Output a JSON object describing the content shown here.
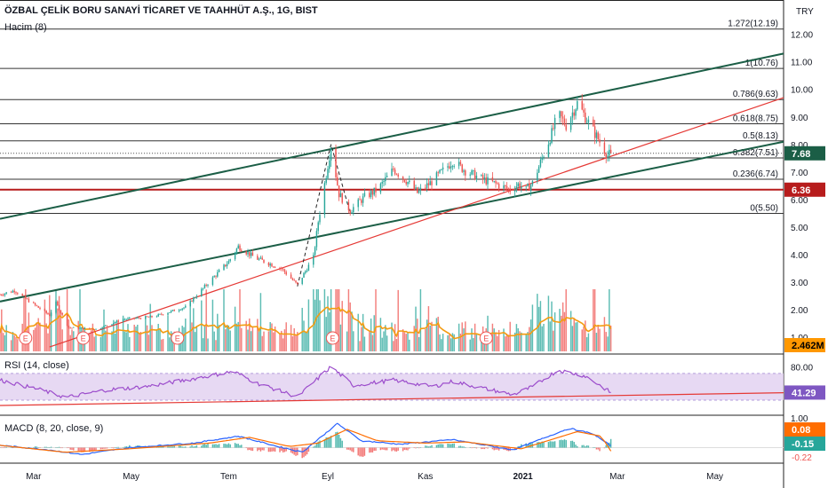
{
  "header": {
    "title": "ÖZBAL ÇELİK BORU SANAYİ TİCARET VE TAAHHÜT A.Ş., 1G, BIST",
    "volume_label": "Hacim (8)",
    "currency": "TRY"
  },
  "colors": {
    "up": "#26a69a",
    "down": "#ef5350",
    "channel": "#1b5e46",
    "trend": "#e53935",
    "support": "#b71c1c",
    "fib": "#333333",
    "vol_ma": "#f39c12",
    "rsi": "#9c4dcc",
    "rsi_band": "#e1d0f0",
    "macd": "#2962ff",
    "signal": "#ff6d00",
    "last_price_bg": "#1b5e46",
    "support_label_bg": "#b71c1c"
  },
  "chart_data": [
    {
      "type": "candlestick",
      "name": "price",
      "y_axis_ticks": [
        "12.00",
        "11.00",
        "10.00",
        "9.00",
        "8.00",
        "7.00",
        "6.00",
        "5.00",
        "4.00",
        "3.00",
        "2.00",
        "1.00"
      ],
      "x_axis_ticks": [
        {
          "label": "Mar",
          "day": 0
        },
        {
          "label": "May",
          "day": 61
        },
        {
          "label": "Tem",
          "day": 122
        },
        {
          "label": "Eyl",
          "day": 184
        },
        {
          "label": "Kas",
          "day": 245
        },
        {
          "label": "2021",
          "day": 306
        },
        {
          "label": "Mar",
          "day": 365
        },
        {
          "label": "May",
          "day": 426
        }
      ],
      "x_range_days": [
        -21,
        469
      ],
      "y_range": [
        0.62,
        12.6
      ],
      "price_anchors": [
        {
          "day": -21,
          "price": 2.55
        },
        {
          "day": -12,
          "price": 2.7
        },
        {
          "day": 0,
          "price": 2.2
        },
        {
          "day": 10,
          "price": 1.8
        },
        {
          "day": 14,
          "price": 2.25
        },
        {
          "day": 22,
          "price": 1.35
        },
        {
          "day": 40,
          "price": 1.3
        },
        {
          "day": 55,
          "price": 1.65
        },
        {
          "day": 75,
          "price": 1.75
        },
        {
          "day": 95,
          "price": 2.1
        },
        {
          "day": 108,
          "price": 2.9
        },
        {
          "day": 122,
          "price": 3.75
        },
        {
          "day": 128,
          "price": 4.3
        },
        {
          "day": 138,
          "price": 3.9
        },
        {
          "day": 155,
          "price": 3.5
        },
        {
          "day": 165,
          "price": 2.9
        },
        {
          "day": 175,
          "price": 3.9
        },
        {
          "day": 178,
          "price": 5.2
        },
        {
          "day": 186,
          "price": 7.95
        },
        {
          "day": 191,
          "price": 6.2
        },
        {
          "day": 198,
          "price": 5.6
        },
        {
          "day": 207,
          "price": 6.1
        },
        {
          "day": 215,
          "price": 6.35
        },
        {
          "day": 225,
          "price": 7.1
        },
        {
          "day": 233,
          "price": 6.7
        },
        {
          "day": 240,
          "price": 6.25
        },
        {
          "day": 248,
          "price": 6.6
        },
        {
          "day": 257,
          "price": 7.1
        },
        {
          "day": 262,
          "price": 7.4
        },
        {
          "day": 270,
          "price": 7.05
        },
        {
          "day": 280,
          "price": 6.75
        },
        {
          "day": 290,
          "price": 6.55
        },
        {
          "day": 298,
          "price": 6.35
        },
        {
          "day": 303,
          "price": 6.55
        },
        {
          "day": 308,
          "price": 6.35
        },
        {
          "day": 312,
          "price": 6.6
        },
        {
          "day": 318,
          "price": 7.5
        },
        {
          "day": 324,
          "price": 8.4
        },
        {
          "day": 328,
          "price": 9.1
        },
        {
          "day": 333,
          "price": 8.7
        },
        {
          "day": 340,
          "price": 9.5
        },
        {
          "day": 345,
          "price": 9.0
        },
        {
          "day": 352,
          "price": 8.3
        },
        {
          "day": 359,
          "price": 7.6
        },
        {
          "day": 361,
          "price": 7.68
        }
      ],
      "last_price": "7.68",
      "support_level": "6.36",
      "fib_levels": [
        {
          "label": "1.272(12.19)",
          "price": 12.19
        },
        {
          "label": "1(10.76)",
          "price": 10.76
        },
        {
          "label": "0.786(9.63)",
          "price": 9.63
        },
        {
          "label": "0.618(8.75)",
          "price": 8.75
        },
        {
          "label": "0.5(8.13)",
          "price": 8.13
        },
        {
          "label": "0.382(7.51)",
          "price": 7.51
        },
        {
          "label": "0.236(6.74)",
          "price": 6.74
        },
        {
          "label": "0(5.50)",
          "price": 5.5
        }
      ],
      "channel_upper": [
        {
          "day": -21,
          "price": 5.3
        },
        {
          "day": 469,
          "price": 11.3
        }
      ],
      "channel_lower": [
        {
          "day": -21,
          "price": 2.3
        },
        {
          "day": 469,
          "price": 8.1
        }
      ],
      "trendline": [
        {
          "day": 10,
          "price": 0.65
        },
        {
          "day": 469,
          "price": 9.7
        }
      ],
      "zigzag": [
        {
          "day": 165,
          "price": 2.85
        },
        {
          "day": 186,
          "price": 8.0
        },
        {
          "day": 198,
          "price": 5.5
        }
      ],
      "earnings_markers": {
        "label": "E",
        "days": [
          -5,
          31,
          90,
          187,
          283
        ]
      }
    },
    {
      "type": "bar",
      "name": "volume",
      "last_value": "2.462M",
      "volume_ma_period": 8
    },
    {
      "type": "line",
      "name": "rsi",
      "label": "RSI (14, close)",
      "y_ticks": [
        "80.00"
      ],
      "band": [
        30,
        70
      ],
      "last_value": "41.29",
      "anchors": [
        {
          "day": -21,
          "value": 60
        },
        {
          "day": 5,
          "value": 45
        },
        {
          "day": 20,
          "value": 34
        },
        {
          "day": 45,
          "value": 45
        },
        {
          "day": 70,
          "value": 50
        },
        {
          "day": 100,
          "value": 62
        },
        {
          "day": 125,
          "value": 73
        },
        {
          "day": 140,
          "value": 55
        },
        {
          "day": 165,
          "value": 35
        },
        {
          "day": 186,
          "value": 80
        },
        {
          "day": 200,
          "value": 52
        },
        {
          "day": 225,
          "value": 60
        },
        {
          "day": 250,
          "value": 50
        },
        {
          "day": 262,
          "value": 58
        },
        {
          "day": 300,
          "value": 38
        },
        {
          "day": 312,
          "value": 50
        },
        {
          "day": 328,
          "value": 75
        },
        {
          "day": 345,
          "value": 66
        },
        {
          "day": 361,
          "value": 41.29
        }
      ],
      "trend_line": [
        {
          "day": -21,
          "value": 22
        },
        {
          "day": 469,
          "value": 41
        }
      ]
    },
    {
      "type": "line",
      "name": "macd",
      "label": "MACD (8, 20, close, 9)",
      "y_ticks": [
        "1.00"
      ],
      "macd_value": "0.08",
      "signal_value": "-0.15",
      "histogram_value": "-0.22",
      "macd_anchors": [
        {
          "day": -21,
          "value": 0.1
        },
        {
          "day": 10,
          "value": -0.1
        },
        {
          "day": 30,
          "value": -0.3
        },
        {
          "day": 60,
          "value": 0.0
        },
        {
          "day": 100,
          "value": 0.2
        },
        {
          "day": 128,
          "value": 0.5
        },
        {
          "day": 150,
          "value": 0.1
        },
        {
          "day": 168,
          "value": -0.2
        },
        {
          "day": 190,
          "value": 1.05
        },
        {
          "day": 205,
          "value": 0.3
        },
        {
          "day": 230,
          "value": 0.15
        },
        {
          "day": 262,
          "value": 0.35
        },
        {
          "day": 300,
          "value": -0.1
        },
        {
          "day": 335,
          "value": 0.85
        },
        {
          "day": 350,
          "value": 0.6
        },
        {
          "day": 361,
          "value": 0.08
        }
      ],
      "signal_anchors": [
        {
          "day": -21,
          "value": 0.1
        },
        {
          "day": 20,
          "value": -0.2
        },
        {
          "day": 60,
          "value": -0.05
        },
        {
          "day": 110,
          "value": 0.2
        },
        {
          "day": 135,
          "value": 0.45
        },
        {
          "day": 160,
          "value": 0.05
        },
        {
          "day": 178,
          "value": 0.2
        },
        {
          "day": 196,
          "value": 0.8
        },
        {
          "day": 215,
          "value": 0.3
        },
        {
          "day": 245,
          "value": 0.2
        },
        {
          "day": 270,
          "value": 0.25
        },
        {
          "day": 305,
          "value": -0.05
        },
        {
          "day": 340,
          "value": 0.7
        },
        {
          "day": 355,
          "value": 0.5
        },
        {
          "day": 361,
          "value": -0.15
        }
      ]
    }
  ]
}
